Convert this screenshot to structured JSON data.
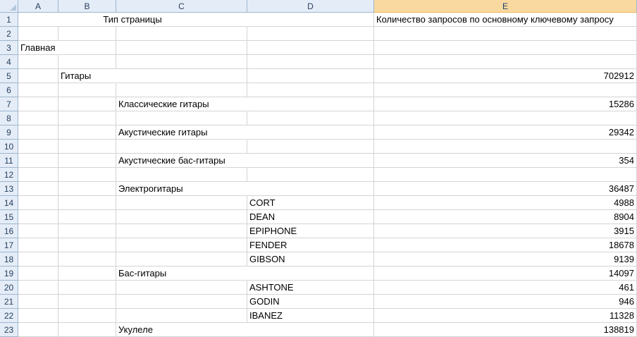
{
  "columns": [
    "A",
    "B",
    "C",
    "D",
    "E"
  ],
  "selected_column": "E",
  "rows": [
    {
      "num": "1",
      "A": "",
      "B": "",
      "C": "Тип страницы",
      "D": "",
      "E": "Количество запросов по основному ключевому запросу"
    },
    {
      "num": "2",
      "A": "",
      "B": "",
      "C": "",
      "D": "",
      "E": ""
    },
    {
      "num": "3",
      "A": "Главная",
      "B": "",
      "C": "",
      "D": "",
      "E": ""
    },
    {
      "num": "4",
      "A": "",
      "B": "",
      "C": "",
      "D": "",
      "E": ""
    },
    {
      "num": "5",
      "A": "",
      "B": "Гитары",
      "C": "",
      "D": "",
      "E": "702912"
    },
    {
      "num": "6",
      "A": "",
      "B": "",
      "C": "",
      "D": "",
      "E": ""
    },
    {
      "num": "7",
      "A": "",
      "B": "",
      "C": "Классические гитары",
      "D": "",
      "E": "15286"
    },
    {
      "num": "8",
      "A": "",
      "B": "",
      "C": "",
      "D": "",
      "E": ""
    },
    {
      "num": "9",
      "A": "",
      "B": "",
      "C": "Акустические гитары",
      "D": "",
      "E": "29342"
    },
    {
      "num": "10",
      "A": "",
      "B": "",
      "C": "",
      "D": "",
      "E": ""
    },
    {
      "num": "11",
      "A": "",
      "B": "",
      "C": "Акустические бас-гитары",
      "D": "",
      "E": "354"
    },
    {
      "num": "12",
      "A": "",
      "B": "",
      "C": "",
      "D": "",
      "E": ""
    },
    {
      "num": "13",
      "A": "",
      "B": "",
      "C": "Электрогитары",
      "D": "",
      "E": "36487"
    },
    {
      "num": "14",
      "A": "",
      "B": "",
      "C": "",
      "D": "CORT",
      "E": "4988"
    },
    {
      "num": "15",
      "A": "",
      "B": "",
      "C": "",
      "D": "DEAN",
      "E": "8904"
    },
    {
      "num": "16",
      "A": "",
      "B": "",
      "C": "",
      "D": "EPIPHONE",
      "E": "3915"
    },
    {
      "num": "17",
      "A": "",
      "B": "",
      "C": "",
      "D": "FENDER",
      "E": "18678"
    },
    {
      "num": "18",
      "A": "",
      "B": "",
      "C": "",
      "D": "GIBSON",
      "E": "9139"
    },
    {
      "num": "19",
      "A": "",
      "B": "",
      "C": "Бас-гитары",
      "D": "",
      "E": "14097"
    },
    {
      "num": "20",
      "A": "",
      "B": "",
      "C": "",
      "D": "ASHTONE",
      "E": "461"
    },
    {
      "num": "21",
      "A": "",
      "B": "",
      "C": "",
      "D": "GODIN",
      "E": "946"
    },
    {
      "num": "22",
      "A": "",
      "B": "",
      "C": "",
      "D": "IBANEZ",
      "E": "11328"
    },
    {
      "num": "23",
      "A": "",
      "B": "",
      "C": "Укулеле",
      "D": "",
      "E": "138819"
    }
  ]
}
